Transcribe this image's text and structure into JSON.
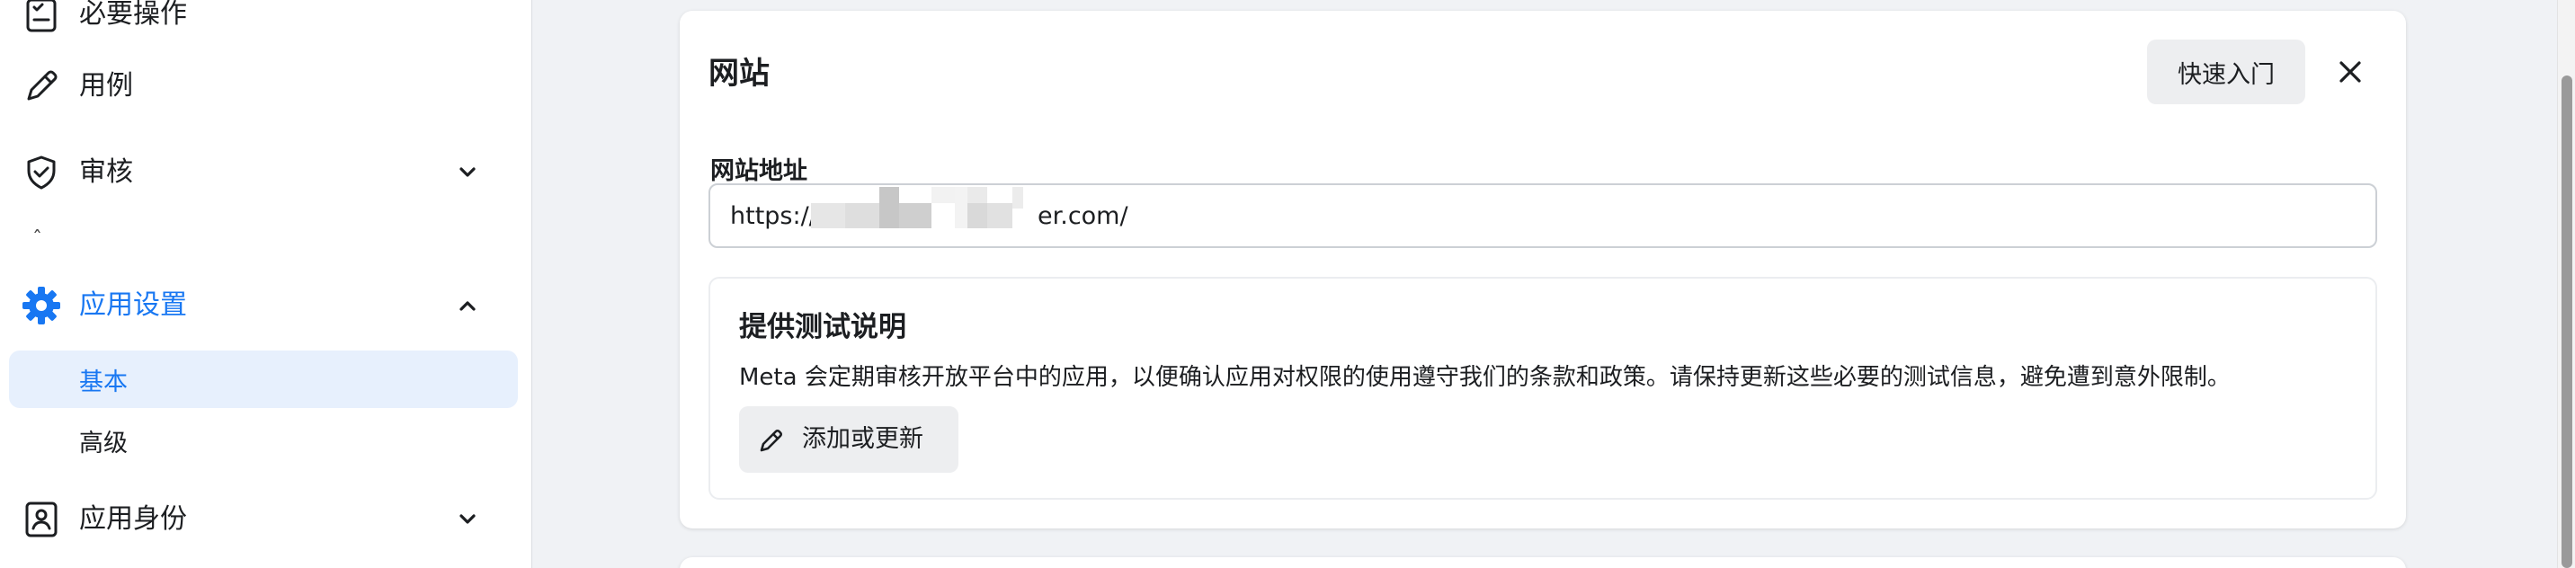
{
  "sidebar": {
    "items": [
      {
        "label": "必要操作",
        "icon": "checklist-icon"
      },
      {
        "label": "用例",
        "icon": "pencil-icon"
      },
      {
        "label": "审核",
        "icon": "shield-check-icon"
      },
      {
        "label": "应用设置",
        "icon": "gear-icon",
        "active": true
      },
      {
        "label": "应用身份",
        "icon": "id-badge-icon"
      }
    ],
    "sub_items": [
      {
        "label": "基本",
        "selected": true
      },
      {
        "label": "高级",
        "selected": false
      }
    ],
    "caret_glyph": "ˆ"
  },
  "website_card": {
    "title": "网站",
    "quick_start_label": "快速入门",
    "url_field": {
      "label": "网站地址",
      "value_prefix": "https://",
      "value_suffix": "er.com/"
    }
  },
  "testing_section": {
    "title": "提供测试说明",
    "description": "Meta 会定期审核开放平台中的应用，以便确认应用对权限的使用遵守我们的条款和政策。请保持更新这些必要的测试信息，避免遭到意外限制。",
    "edit_button_label": "添加或更新"
  },
  "colors": {
    "accent": "#1877f2",
    "selected_bg": "#e7f0fd",
    "page_bg": "#f0f2f5",
    "button_bg": "#edeef0"
  }
}
